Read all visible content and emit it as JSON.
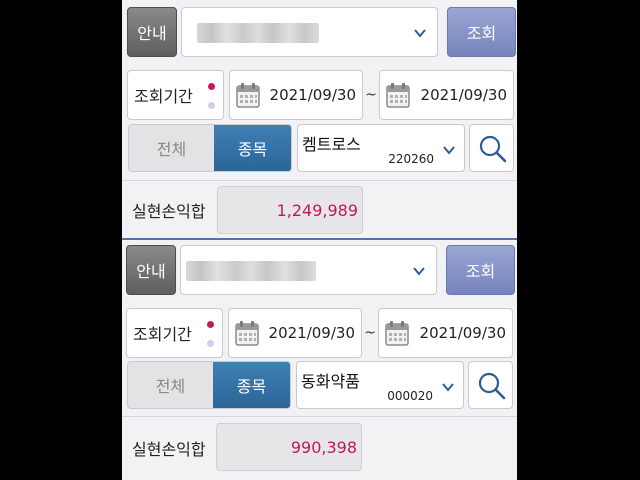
{
  "panels": [
    {
      "info_label": "안내",
      "query_label": "조회",
      "period_label": "조회기간",
      "date_from": "2021/09/30",
      "date_sep": "~",
      "date_to": "2021/09/30",
      "tab_all": "전체",
      "tab_stock": "종목",
      "stock_name": "켐트로스",
      "stock_code": "220260",
      "realized_pl_label": "실현손익합",
      "realized_pl_value": "1,249,989"
    },
    {
      "info_label": "안내",
      "query_label": "조회",
      "period_label": "조회기간",
      "date_from": "2021/09/30",
      "date_sep": "~",
      "date_to": "2021/09/30",
      "tab_all": "전체",
      "tab_stock": "종목",
      "stock_name": "동화약품",
      "stock_code": "000020",
      "realized_pl_label": "실현손익합",
      "realized_pl_value": "990,398"
    }
  ],
  "icons": {
    "dropdown": "chevron-down-icon",
    "calendar": "calendar-icon",
    "search": "search-icon"
  },
  "colors": {
    "query_button": "#8a96c8",
    "active_tab": "#3573a8",
    "pl_value": "#c2185b",
    "period_dot_active": "#c6185d"
  }
}
